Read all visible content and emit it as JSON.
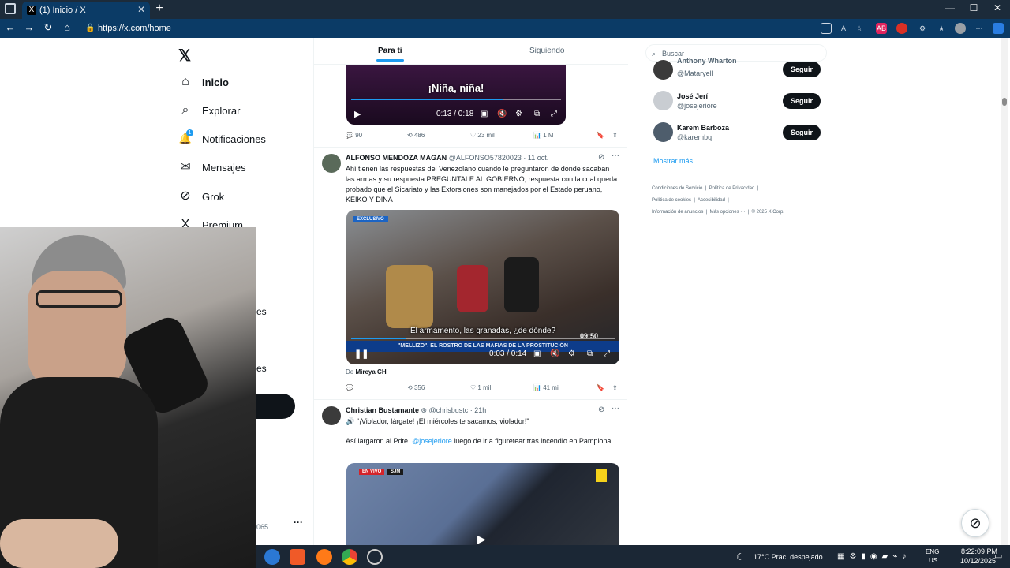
{
  "browser": {
    "tab_title": "(1) Inicio / X",
    "tab_close": "✕",
    "new_tab": "+",
    "url": "https://x.com/home",
    "window_controls": [
      "—",
      "☐",
      "✕"
    ]
  },
  "nav": {
    "items": [
      {
        "label": "Inicio",
        "icon": "home-icon",
        "glyph": "⌂"
      },
      {
        "label": "Explorar",
        "icon": "search-icon",
        "glyph": "⌕"
      },
      {
        "label": "Notificaciones",
        "icon": "bell-icon",
        "glyph": "🔔",
        "badge": "1"
      },
      {
        "label": "Mensajes",
        "icon": "mail-icon",
        "glyph": "✉"
      },
      {
        "label": "Grok",
        "icon": "grok-icon",
        "glyph": "⊘"
      },
      {
        "label": "Premium",
        "icon": "x-icon",
        "glyph": "X"
      }
    ],
    "partial_label_1": "es",
    "partial_label_2": "es",
    "partial_number": "065",
    "more": "···"
  },
  "feed_tabs": [
    "Para ti",
    "Siguiendo"
  ],
  "tweet1": {
    "video_caption": "¡Niña, niña!",
    "video_time": "0:13 / 0:18",
    "progress": 0.72,
    "replies": "90",
    "reposts": "486",
    "likes": "23 mil",
    "views": "1 M"
  },
  "tweet2": {
    "name": "ALFONSO MENDOZA MAGAN",
    "handle": "@ALFONSO57820023",
    "date": "· 11 oct.",
    "text": "Ahí tienen las respuestas del Venezolano cuando le preguntaron de donde sacaban las armas y su respuesta PREGUNTALE AL GOBIERNO, respuesta con la cual queda probado que el Sicariato y las Extorsiones son manejados por el Estado peruano, KEIKO Y DINA",
    "video_badge": "EXCLUSIVO",
    "video_subtitle": "El armamento, las granadas, ¿de dónde?",
    "video_banner": "\"MELLIZO\", EL ROSTRO DE LAS MAFIAS DE LA PROSTITUCIÓN",
    "video_clock": "09:50",
    "video_time": "0:03 / 0:14",
    "progress": 0.21,
    "from_label": "De",
    "from_user": "Mireya CH",
    "replies": "",
    "reposts": "356",
    "likes": "1 mil",
    "views": "41 mil"
  },
  "tweet3": {
    "name": "Christian Bustamante",
    "handle": "@chrisbustc",
    "date": "· 21h",
    "line1": "🔊 \"¡Violador, lárgate! ¡El miércoles te sacamos, violador!\"",
    "line2_pre": "Así largaron al Pdte.",
    "mention": "@josejeriore",
    "line2_post": "luego de ir a figuretear tras incendio en Pamplona.",
    "live_badge": "EN VIVO",
    "place_badge": "SJM"
  },
  "search": {
    "placeholder": "Buscar"
  },
  "who_to_follow": [
    {
      "name": "Anthony Wharton",
      "handle": "@Mataryell",
      "button": "Seguir"
    },
    {
      "name": "José Jerí",
      "handle": "@josejeriore",
      "button": "Seguir"
    },
    {
      "name": "Karem Barboza",
      "handle": "@karembq",
      "button": "Seguir"
    }
  ],
  "show_more": "Mostrar más",
  "footer": {
    "line1": [
      "Condiciones de Servicio",
      "Política de Privacidad"
    ],
    "line2": [
      "Política de cookies",
      "Accesibilidad"
    ],
    "line3": [
      "Información de anuncios",
      "Más opciones ···",
      "© 2025 X Corp."
    ]
  },
  "taskbar": {
    "weather": "17°C  Prac. despejado",
    "lang": "ENG",
    "region": "US",
    "time": "8:22:09 PM",
    "date": "10/12/2025"
  },
  "colors": {
    "accent": "#1d9bf0",
    "browser_bar": "#0b3b66",
    "text": "#0f1419",
    "muted": "#536471"
  }
}
